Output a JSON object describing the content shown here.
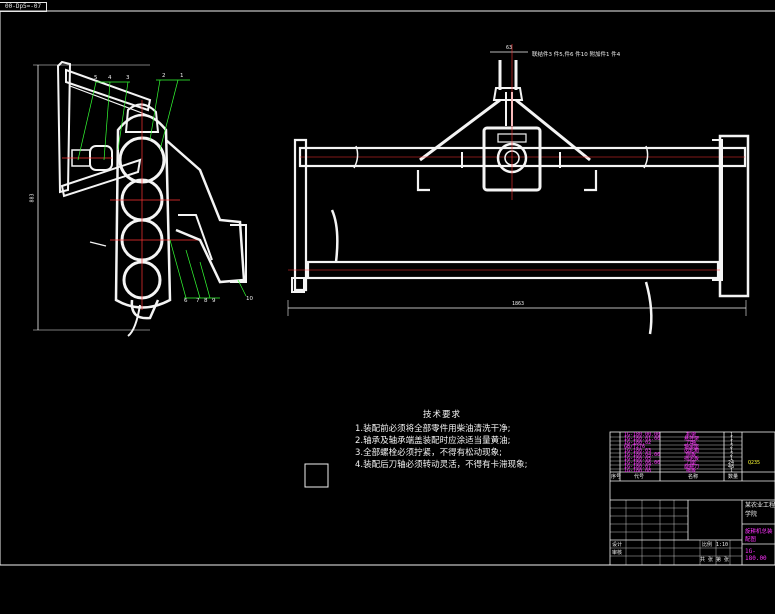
{
  "tab_label": "00-Dp5=-07",
  "front_view": {
    "part_numbers_top": [
      "5",
      "4",
      "3",
      "2",
      "1"
    ],
    "part_numbers_bottom": [
      "6",
      "7",
      "8",
      "9",
      "10"
    ],
    "height_dim": "883"
  },
  "side_view": {
    "top_note": "联结件3 件5,件6 件10 附加件1 件4",
    "top_dim": "63",
    "width_dim": "1863"
  },
  "tech_notes": {
    "title": "技术要求",
    "items": [
      "1.装配前必须将全部零件用柴油清洗干净;",
      "2.轴承及轴承端盖装配时应涂适当量黄油;",
      "3.全部螺栓必须拧紧，不得有松动现象;",
      "4.装配后刀轴必须转动灵活，不得有卡滞现象;"
    ]
  },
  "title_block": {
    "parts": [
      {
        "code": "1G-180.00.00",
        "name": "机架",
        "qty": "1"
      },
      {
        "code": "1G-180.01.00",
        "name": "悬挂架",
        "qty": "1"
      },
      {
        "code": "1G-180.02",
        "name": "刀轴",
        "qty": "1"
      },
      {
        "code": "GB/T276",
        "name": "轴承座",
        "qty": "2"
      },
      {
        "code": "1G-180.03",
        "name": "齿轮箱",
        "qty": "1"
      },
      {
        "code": "1G-180.04.00",
        "name": "侧板",
        "qty": "2"
      },
      {
        "code": "1G-180.05",
        "name": "挡泥板",
        "qty": "1"
      },
      {
        "code": "1G-180.06.00",
        "name": "刀座",
        "qty": "24"
      },
      {
        "code": "1G-180.07",
        "name": "旋耕刀",
        "qty": "48"
      },
      {
        "code": "1G-180.08",
        "name": "拖板",
        "qty": "1"
      }
    ],
    "header_left": "序号",
    "header_code": "代号",
    "header_name": "名称",
    "header_qty": "数量",
    "school": "某农业工程学院",
    "drawing_name": "旋耕机总装配图",
    "drawing_code": "1G-180.00",
    "scale_label": "比例",
    "scale_value": "1:10",
    "sheet_label": "共 张 第 张",
    "designer_label": "设计",
    "checker_label": "审核",
    "material_note": "Q235"
  }
}
